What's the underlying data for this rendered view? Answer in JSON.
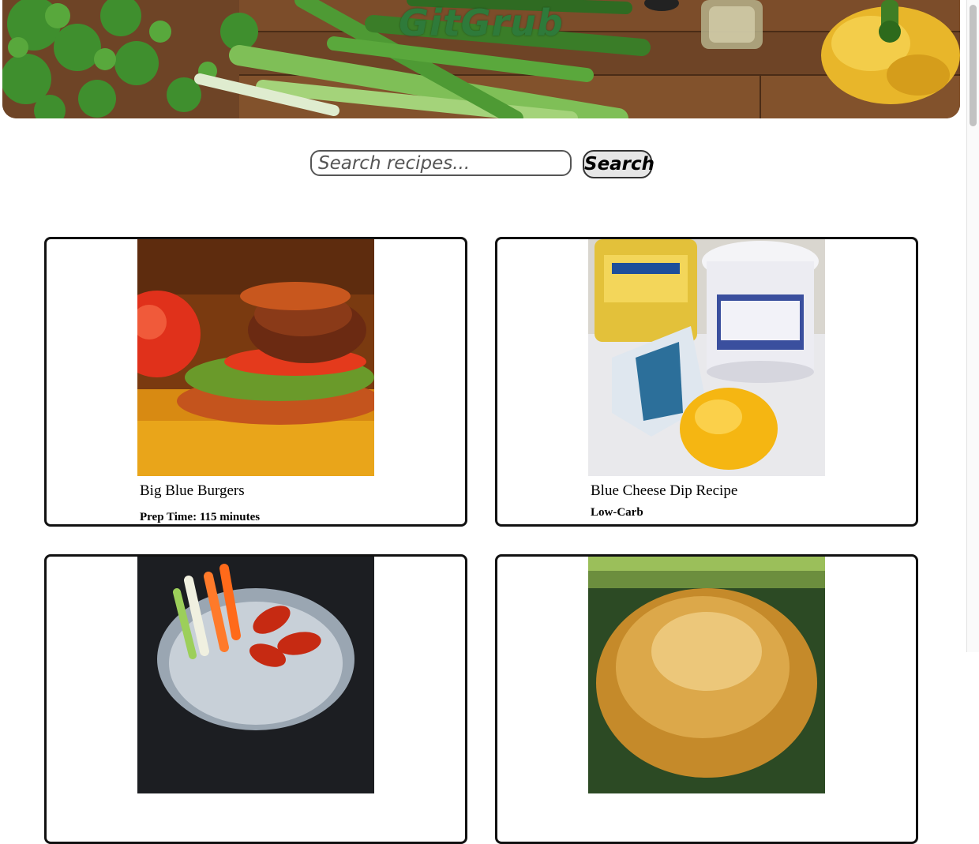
{
  "header": {
    "site_title": "GitGrub"
  },
  "search": {
    "placeholder": "Search recipes...",
    "button_label": "Search"
  },
  "recipes": [
    {
      "title": "Big Blue Burgers",
      "meta": "Prep Time: 115 minutes"
    },
    {
      "title": "Blue Cheese Dip Recipe",
      "meta": "Low-Carb"
    },
    {
      "title": "",
      "meta": ""
    },
    {
      "title": "",
      "meta": ""
    }
  ],
  "colors": {
    "title_green": "#2e7a3a",
    "card_border": "#111111",
    "button_bg": "#e6e6e6"
  }
}
